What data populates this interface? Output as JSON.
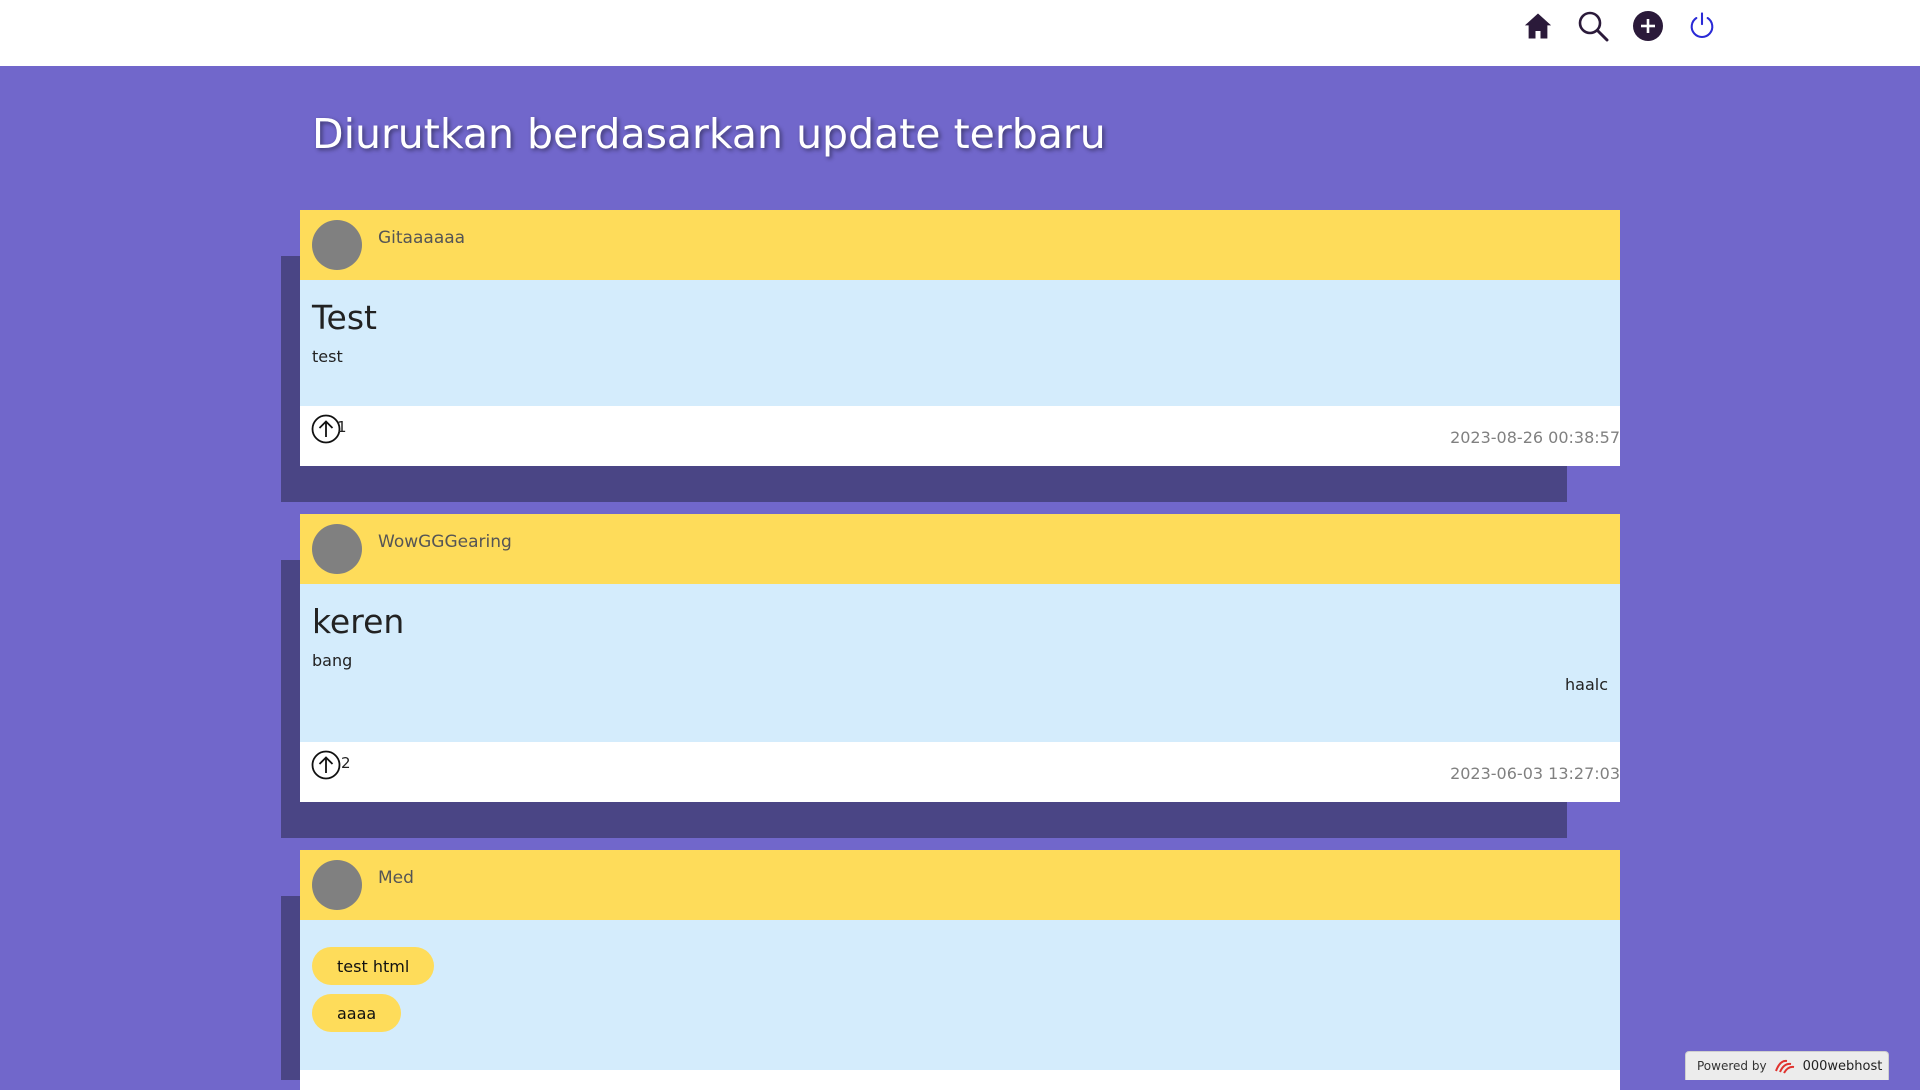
{
  "nav": {
    "icons": [
      "home-icon",
      "search-icon",
      "add-icon",
      "power-icon"
    ]
  },
  "page": {
    "title": "Diurutkan berdasarkan update terbaru"
  },
  "posts": [
    {
      "author": "Gitaaaaaa",
      "title": "Test",
      "text": "test",
      "votes": "1",
      "timestamp": "2023-08-26 00:38:57"
    },
    {
      "author": "WowGGGearing",
      "title": "keren",
      "text": "bang",
      "right_text": "haalc",
      "votes": "2",
      "timestamp": "2023-06-03 13:27:03"
    },
    {
      "author": "Med",
      "tags": [
        "test html",
        "aaaa"
      ]
    }
  ],
  "footer_badge": {
    "prefix": "Powered by",
    "brand": "000webhost"
  },
  "colors": {
    "background": "#7167cb",
    "shadow": "#4a4585",
    "header": "#fedc5a",
    "body": "#d4ecfc",
    "icon_dark": "#2b1a3a",
    "icon_power": "#2a2ad6"
  }
}
